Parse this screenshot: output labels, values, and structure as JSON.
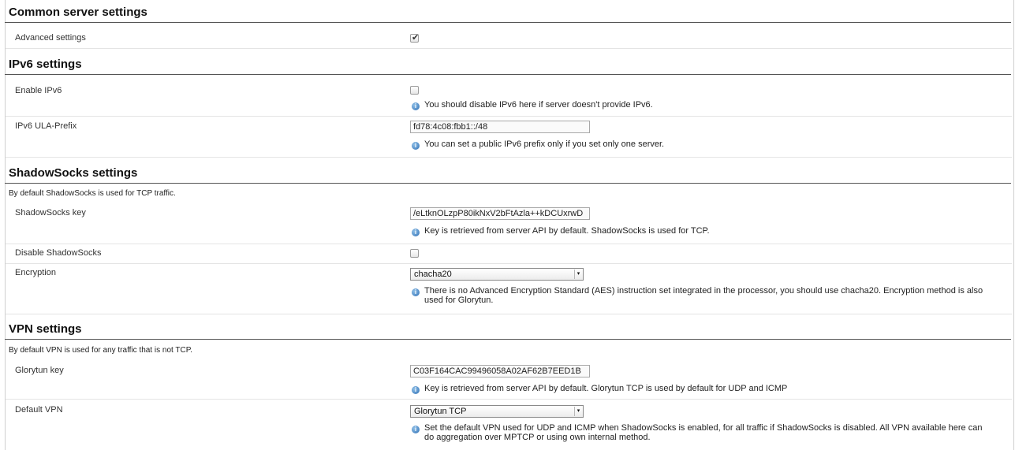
{
  "sections": {
    "common": {
      "title": "Common server settings",
      "advanced_label": "Advanced settings",
      "advanced_checked": true
    },
    "ipv6": {
      "title": "IPv6 settings",
      "enable_label": "Enable IPv6",
      "enable_checked": false,
      "enable_hint": "You should disable IPv6 here if server doesn't provide IPv6.",
      "ula_label": "IPv6 ULA-Prefix",
      "ula_value": "fd78:4c08:fbb1::/48",
      "ula_hint": "You can set a public IPv6 prefix only if you set only one server."
    },
    "shadowsocks": {
      "title": "ShadowSocks settings",
      "description": "By default ShadowSocks is used for TCP traffic.",
      "key_label": "ShadowSocks key",
      "key_value": "/eLtknOLzpP80ikNxV2bFtAzla++kDCUxrwD",
      "key_hint": "Key is retrieved from server API by default. ShadowSocks is used for TCP.",
      "disable_label": "Disable ShadowSocks",
      "disable_checked": false,
      "encryption_label": "Encryption",
      "encryption_value": "chacha20",
      "encryption_hint": "There is no Advanced Encryption Standard (AES) instruction set integrated in the processor, you should use chacha20. Encryption method is also used for Glorytun."
    },
    "vpn": {
      "title": "VPN settings",
      "description": "By default VPN is used for any traffic that is not TCP.",
      "glorytun_label": "Glorytun key",
      "glorytun_value": "C03F164CAC99496058A02AF62B7EED1B",
      "glorytun_hint": "Key is retrieved from server API by default. Glorytun TCP is used by default for UDP and ICMP",
      "default_vpn_label": "Default VPN",
      "default_vpn_value": "Glorytun TCP",
      "default_vpn_hint": "Set the default VPN used for UDP and ICMP when ShadowSocks is enabled, for all traffic if ShadowSocks is disabled. All VPN available here can do aggregation over MPTCP or using own internal method."
    }
  },
  "icons": {
    "info": "info-icon",
    "check": "check-icon",
    "dropdown": "dropdown-arrow-icon"
  },
  "glyphs": {
    "check": "✔",
    "info": "i",
    "arrow": "▾"
  }
}
